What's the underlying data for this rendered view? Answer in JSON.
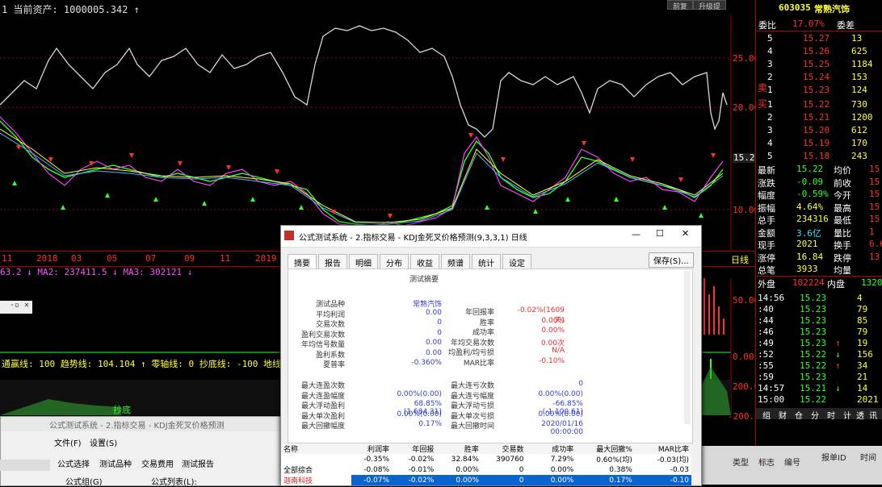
{
  "topbar": {
    "asset_text": "1  当前资产: 1000005.342 ↑",
    "btn1": "前复",
    "btn2": "升级提"
  },
  "chart": {
    "price_axis": [
      "25.00",
      "20.00",
      "15.22",
      "10.00"
    ],
    "year_labels": [
      "11",
      "2018",
      "03",
      "05",
      "07",
      "09",
      "11",
      "2019"
    ],
    "ma_text": "63.2 ↓  MA2: 237411.5 ↓  MA3: 302121 ↓",
    "indicator_axis": [
      "50.00",
      "0.00",
      "200.00",
      "-200.00"
    ],
    "indicator_line": "通赢线: 100  趋势线: 104.104 ↑  零轴线: 0  抄底线: -100  地线: -200",
    "bottom_label": "抄底",
    "axis_side_label": "日线",
    "left_small_box": "-▫ ✕",
    "bottom_left_num": "57.14(2.8"
  },
  "quote": {
    "code": "603035",
    "name": "常熟汽饰",
    "weibi_label": "委比",
    "weibi_val": "17.07%",
    "weicha_label": "委差",
    "sell_label": "卖",
    "buy_label": "买",
    "sells": [
      {
        "lvl": "5",
        "price": "15.27",
        "vol": "13"
      },
      {
        "lvl": "4",
        "price": "15.26",
        "vol": "625"
      },
      {
        "lvl": "3",
        "price": "15.25",
        "vol": "1184"
      },
      {
        "lvl": "2",
        "price": "15.24",
        "vol": "153"
      },
      {
        "lvl": "1",
        "price": "15.23",
        "vol": "124"
      }
    ],
    "buys": [
      {
        "lvl": "1",
        "price": "15.22",
        "vol": "730"
      },
      {
        "lvl": "2",
        "price": "15.21",
        "vol": "1200"
      },
      {
        "lvl": "3",
        "price": "15.20",
        "vol": "612"
      },
      {
        "lvl": "4",
        "price": "15.19",
        "vol": "170"
      },
      {
        "lvl": "5",
        "price": "15.18",
        "vol": "243"
      }
    ],
    "stats": [
      {
        "l1": "最新",
        "v1": "15.22",
        "l2": "均价",
        "v2": "15"
      },
      {
        "l1": "涨跌",
        "v1": "-0.09",
        "l2": "前收",
        "v2": "15"
      },
      {
        "l1": "幅度",
        "v1": "-0.59%",
        "l2": "今开",
        "v2": "15"
      },
      {
        "l1": "振幅",
        "v1": "4.64%",
        "l2": "最高",
        "v2": "15"
      },
      {
        "l1": "总手",
        "v1": "234316",
        "l2": "最低",
        "v2": "15"
      },
      {
        "l1": "金额",
        "v1": "3.6亿",
        "l2": "量比",
        "v2": "1"
      },
      {
        "l1": "现手",
        "v1": "2021",
        "l2": "换手",
        "v2": "6.6"
      },
      {
        "l1": "涨停",
        "v1": "16.84",
        "l2": "跌停",
        "v2": "13"
      },
      {
        "l1": "总笔",
        "v1": "3933",
        "l2": "均量",
        "v2": ""
      }
    ],
    "outer_label": "外盘",
    "outer_val": "102224",
    "inner_label": "内盘",
    "inner_val": "1320",
    "ticks": [
      {
        "t": "14:56",
        "p": "15.23",
        "arrow": "",
        "v": "4"
      },
      {
        "t": ":40",
        "p": "15.23",
        "arrow": "",
        "v": "79"
      },
      {
        "t": ":44",
        "p": "15.23",
        "arrow": "",
        "v": "85"
      },
      {
        "t": ":46",
        "p": "15.23",
        "arrow": "",
        "v": "79"
      },
      {
        "t": ":49",
        "p": "15.23",
        "arrow": "↑",
        "v": "19"
      },
      {
        "t": ":52",
        "p": "15.22",
        "arrow": "↓",
        "v": "156"
      },
      {
        "t": ":55",
        "p": "15.22",
        "arrow": "↑",
        "v": "34"
      },
      {
        "t": ":59",
        "p": "15.23",
        "arrow": "",
        "v": "21"
      },
      {
        "t": "14:57",
        "p": "15.21",
        "arrow": "↓",
        "v": "14"
      },
      {
        "t": "15:00",
        "p": "15.22",
        "arrow": "",
        "v": "2021"
      }
    ],
    "bottom_tabs": [
      "组",
      "财",
      "仓",
      "分",
      "时",
      "计",
      "透",
      "讯"
    ]
  },
  "dlg1": {
    "title": "公式测试系统 - 2.指标交易 - KDJ金死叉价格预测",
    "menu": [
      "文件(F)",
      "设置(S)"
    ],
    "tabs": [
      "公式选择",
      "测试品种",
      "交易费用",
      "测试报告"
    ],
    "row": [
      "公式组(G)",
      "公式列表(L):"
    ]
  },
  "dlg2": {
    "title": "公式测试系统 - 2.指标交易 - KDJ金死叉价格预测(9,3,3,1) 日线",
    "min": "—",
    "max": "☐",
    "close": "✕",
    "tabs": [
      "摘要",
      "报告",
      "明细",
      "分布",
      "收益",
      "频谱",
      "统计",
      "设定"
    ],
    "save": "保存(S)...",
    "summary_title": "测试摘要",
    "left_labels": [
      "测试品种",
      "平均利润",
      "交易次数",
      "盈利交易次数",
      "年均信号数量",
      "盈利系数",
      "夏普率"
    ],
    "left_values": [
      "常熟汽饰",
      "0.00",
      "0",
      "0",
      "0.00",
      "0.00",
      "-0.360%"
    ],
    "right_labels": [
      "年回报率",
      "胜率",
      "成功率",
      "年均交易次数",
      "均盈利/均亏损",
      "MAR比率"
    ],
    "right_values": [
      "-0.02%(1609天)",
      "0.00%",
      "0.00%",
      "0.00次",
      "N/A",
      "-0.10%"
    ],
    "lower_left_labels": [
      "最大连盈次数",
      "最大连盈幅度",
      "最大浮动盈利",
      "最大单次盈利",
      "最大回撤幅度"
    ],
    "lower_left_values": [
      "",
      "0.00%(0.00)",
      "68.85%(1,684.31)",
      "0.00%(0.00)",
      "0.17%"
    ],
    "lower_right_labels": [
      "最大连亏次数",
      "最大连亏幅度",
      "最大浮动亏损",
      "最大单次亏损",
      "最大回撤时间"
    ],
    "lower_right_values": [
      "0",
      "0.00%(0.00)",
      "-66.85%(-1,100.61)",
      "0.00%(0.00)",
      "2020/01/16 00:00:00"
    ],
    "table_headers": [
      "名称",
      "利润率",
      "年回报",
      "胜率",
      "交易数",
      "成功率",
      "最大回撤%",
      "MAR比率"
    ],
    "rows": [
      [
        "",
        "-0.35%",
        "-0.02%",
        "32.84%",
        "390760",
        "7.29%",
        "0.60%(均)",
        "-0.03(均)"
      ],
      [
        "全部综合",
        "-0.08%",
        "-0.01%",
        "0.00%",
        "0",
        "0.00%",
        "0.38%",
        "-0.03"
      ],
      [
        "迦南科技",
        "-0.07%",
        "-0.02%",
        "0.00%",
        "0",
        "0.00%",
        "0.17%",
        "-0.10"
      ]
    ]
  },
  "right_bottom_tabs": [
    "类型",
    "标志",
    "编号",
    "报单ID",
    "时间"
  ]
}
